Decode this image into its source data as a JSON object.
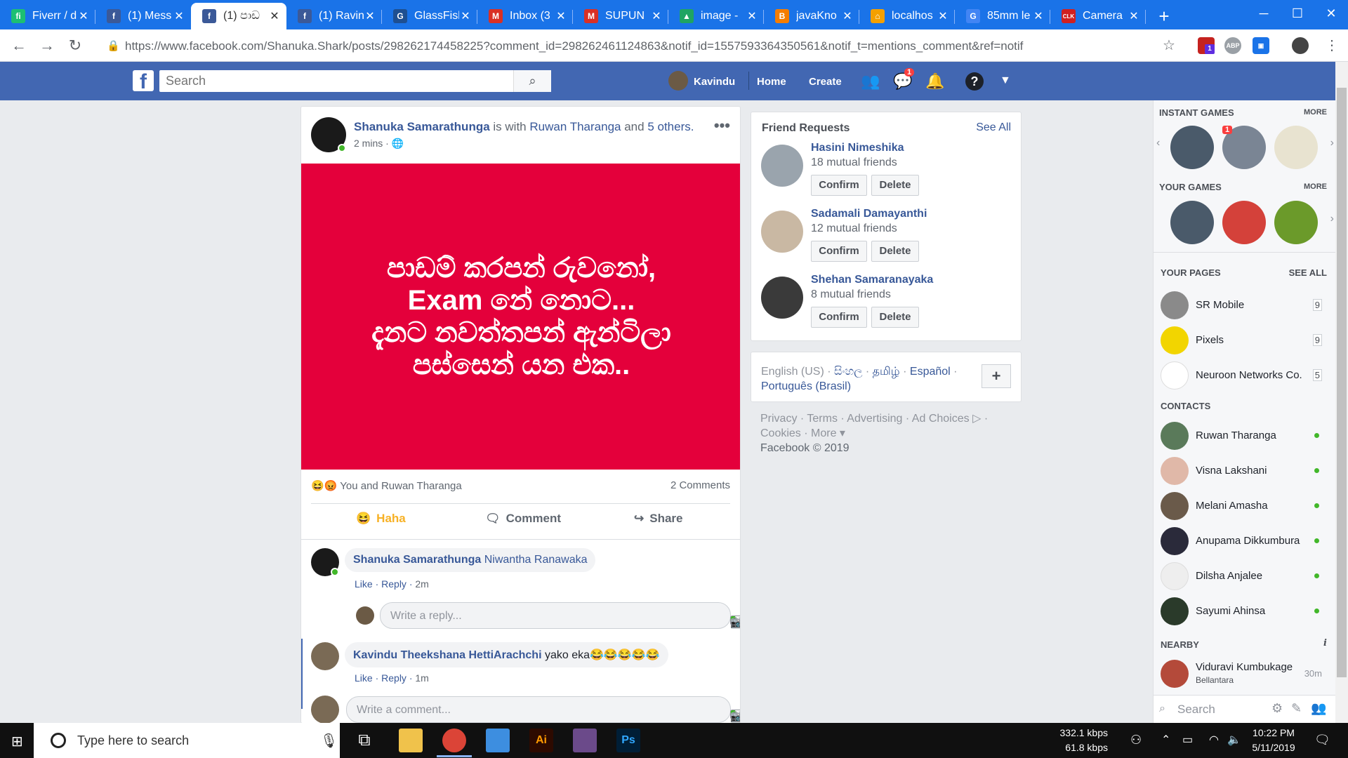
{
  "browser": {
    "tabs": [
      {
        "title": "Fiverr / d",
        "fav": "fi",
        "color": "#1dbf73"
      },
      {
        "title": "(1) Mess",
        "fav": "f",
        "color": "#3b5998"
      },
      {
        "title": "(1) පාඩ",
        "fav": "f",
        "color": "#3b5998"
      },
      {
        "title": "(1) Ravin",
        "fav": "f",
        "color": "#3b5998"
      },
      {
        "title": "GlassFish",
        "fav": "G",
        "color": "#1e4f91"
      },
      {
        "title": "Inbox (3",
        "fav": "M",
        "color": "#d93025"
      },
      {
        "title": "SUPUN",
        "fav": "M",
        "color": "#d93025"
      },
      {
        "title": "image -",
        "fav": "▲",
        "color": "#1fa463"
      },
      {
        "title": "javaKno",
        "fav": "B",
        "color": "#f57d00"
      },
      {
        "title": "localhos",
        "fav": "⌂",
        "color": "#f4a000"
      },
      {
        "title": "85mm le",
        "fav": "G",
        "color": "#4285f4"
      },
      {
        "title": "Camera",
        "fav": "CLK",
        "color": "#d02020"
      }
    ],
    "active_tab": 2,
    "url": "https://www.facebook.com/Shanuka.Shark/posts/298262174458225?comment_id=298262461124863&notif_id=1557593364350561&notif_t=mentions_comment&ref=notif",
    "ext_badge": "1"
  },
  "fb": {
    "search_placeholder": "Search",
    "user": "Kavindu",
    "nav": {
      "home": "Home",
      "create": "Create"
    },
    "messenger_badge": "1"
  },
  "post": {
    "author": "Shanuka Samarathunga",
    "with_text": "is with",
    "tagged": "Ruwan Tharanga",
    "and_text": "and",
    "others": "5 others.",
    "time": "2 mins",
    "body_lines": [
      "පාඩම් කරපන් රුවනෝ,",
      "Exam නේ නොට...",
      "දැනට නවත්තපන් ඇන්ටිලා",
      "පස්සෙන් යන එක.."
    ],
    "reactions_text": "You and Ruwan Tharanga",
    "comments_count": "2 Comments",
    "actions": {
      "haha": "Haha",
      "comment": "Comment",
      "share": "Share"
    },
    "comments": [
      {
        "author": "Shanuka Samarathunga",
        "text": "Niwantha Ranawaka",
        "like": "Like",
        "reply": "Reply",
        "time": "2m"
      },
      {
        "author": "Kavindu Theekshana HettiArachchi",
        "text": "yako eka😂😂😂😂😂",
        "like": "Like",
        "reply": "Reply",
        "time": "1m"
      }
    ],
    "reply_placeholder": "Write a reply...",
    "comment_placeholder": "Write a comment..."
  },
  "friend_requests": {
    "title": "Friend Requests",
    "see_all": "See All",
    "confirm": "Confirm",
    "delete": "Delete",
    "items": [
      {
        "name": "Hasini Nimeshika",
        "mutual": "18 mutual friends"
      },
      {
        "name": "Sadamali Damayanthi",
        "mutual": "12 mutual friends"
      },
      {
        "name": "Shehan Samaranayaka",
        "mutual": "8 mutual friends"
      }
    ]
  },
  "languages": {
    "current": "English (US)",
    "others": [
      "සිංහල",
      "தமிழ்",
      "Español",
      "Português (Brasil)"
    ],
    "sep": "·"
  },
  "footer": {
    "line1": [
      "Privacy",
      "Terms",
      "Advertising",
      "Ad Choices"
    ],
    "line2": [
      "Cookies",
      "More"
    ],
    "copyright": "Facebook © 2019"
  },
  "sidebar": {
    "instant_games": "INSTANT GAMES",
    "your_games": "YOUR GAMES",
    "more": "MORE",
    "game_badge": "1",
    "your_pages": "YOUR PAGES",
    "see_all": "SEE ALL",
    "pages": [
      {
        "name": "SR Mobile",
        "count": "9"
      },
      {
        "name": "Pixels",
        "count": "9"
      },
      {
        "name": "Neuroon Networks Co.",
        "count": "5"
      }
    ],
    "contacts_title": "CONTACTS",
    "contacts": [
      "Ruwan Tharanga",
      "Visna Lakshani",
      "Melani Amasha",
      "Anupama Dikkumbura",
      "Dilsha Anjalee",
      "Sayumi Ahinsa"
    ],
    "nearby_title": "NEARBY",
    "nearby": {
      "name": "Viduravi Kumbukage",
      "place": "Bellantara",
      "time": "30m"
    },
    "search_placeholder": "Search"
  },
  "taskbar": {
    "search": "Type here to search",
    "net_up": "332.1 kbps",
    "net_down": "61.8 kbps",
    "time": "10:22 PM",
    "date": "5/11/2019"
  }
}
